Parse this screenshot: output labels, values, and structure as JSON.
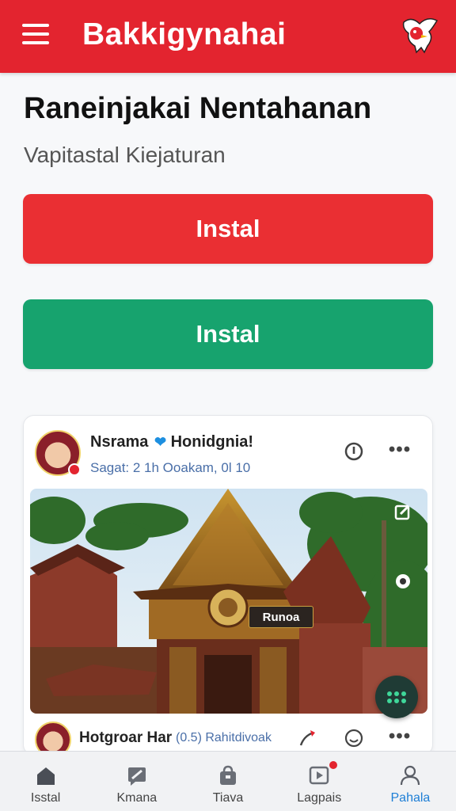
{
  "header": {
    "title": "Bakkigynahai",
    "menu_icon": "hamburger-icon",
    "logo_icon": "bird-logo-icon",
    "color": "#e3242f"
  },
  "page": {
    "title": "Raneinjakai  Nentahanan",
    "subtitle": "Vapitastal Kiejaturan"
  },
  "buttons": {
    "primary_label": "Instal",
    "secondary_label": "Instal",
    "primary_color": "#ea2f33",
    "secondary_color": "#17a36e"
  },
  "post": {
    "author": "Nsrama",
    "author_handle": "Honidgnia!",
    "meta": "Sagat: 2 1h  Ooakam, 0l 10",
    "image_caption": "Runoa",
    "comment_author": "Hotgroar  Har",
    "comment_meta": "(0.5)  Rahitdivoak"
  },
  "nav": {
    "items": [
      {
        "label": "Isstal",
        "icon": "home-icon"
      },
      {
        "label": "Kmana",
        "icon": "chat-edit-icon"
      },
      {
        "label": "Tiava",
        "icon": "bag-icon"
      },
      {
        "label": "Lagpais",
        "icon": "play-icon"
      },
      {
        "label": "Pahala",
        "icon": "profile-icon"
      }
    ],
    "active_color": "#1e7fd6"
  }
}
